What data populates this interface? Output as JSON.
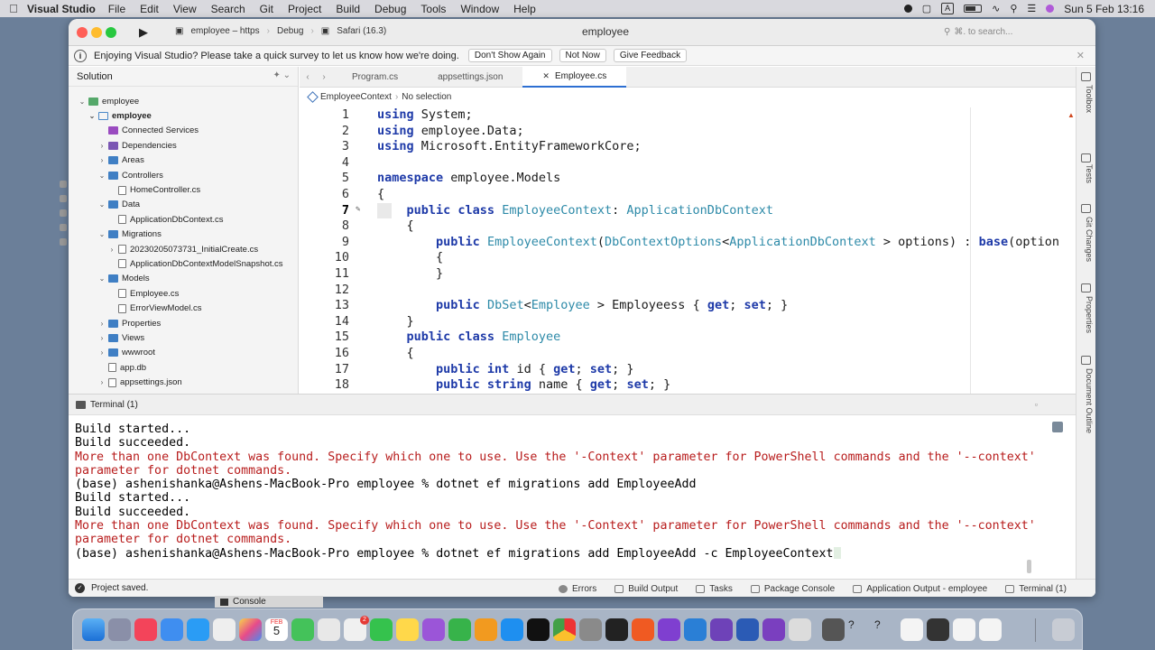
{
  "menubar": {
    "app_name": "Visual Studio",
    "items": [
      "File",
      "Edit",
      "View",
      "Search",
      "Git",
      "Project",
      "Build",
      "Debug",
      "Tools",
      "Window",
      "Help"
    ],
    "input_source": "A",
    "datetime": "Sun 5 Feb  13:16"
  },
  "titlebar": {
    "run_target": "employee – https",
    "configuration": "Debug",
    "device": "Safari (16.3)",
    "window_title": "employee",
    "search_placeholder": "⌘. to search..."
  },
  "infobar": {
    "message": "Enjoying Visual Studio? Please take a quick survey to let us know how we're doing.",
    "buttons": [
      "Don't Show Again",
      "Not Now",
      "Give Feedback"
    ]
  },
  "solution": {
    "title": "Solution",
    "tree": [
      {
        "label": "employee",
        "depth": 0,
        "icon": "sln",
        "chevron": "down",
        "bold": false
      },
      {
        "label": "employee",
        "depth": 1,
        "icon": "prj",
        "chevron": "down",
        "bold": true
      },
      {
        "label": "Connected Services",
        "depth": 2,
        "icon": "svc",
        "chevron": "",
        "bold": false
      },
      {
        "label": "Dependencies",
        "depth": 2,
        "icon": "proj",
        "chevron": "right",
        "bold": false
      },
      {
        "label": "Areas",
        "depth": 2,
        "icon": "folder",
        "chevron": "right",
        "bold": false
      },
      {
        "label": "Controllers",
        "depth": 2,
        "icon": "folder",
        "chevron": "down",
        "bold": false
      },
      {
        "label": "HomeController.cs",
        "depth": 3,
        "icon": "file",
        "chevron": "",
        "bold": false
      },
      {
        "label": "Data",
        "depth": 2,
        "icon": "folder",
        "chevron": "down",
        "bold": false
      },
      {
        "label": "ApplicationDbContext.cs",
        "depth": 3,
        "icon": "file",
        "chevron": "",
        "bold": false
      },
      {
        "label": "Migrations",
        "depth": 2,
        "icon": "folder",
        "chevron": "down",
        "bold": false
      },
      {
        "label": "20230205073731_InitialCreate.cs",
        "depth": 3,
        "icon": "file",
        "chevron": "right",
        "bold": false
      },
      {
        "label": "ApplicationDbContextModelSnapshot.cs",
        "depth": 3,
        "icon": "file",
        "chevron": "",
        "bold": false
      },
      {
        "label": "Models",
        "depth": 2,
        "icon": "folder",
        "chevron": "down",
        "bold": false
      },
      {
        "label": "Employee.cs",
        "depth": 3,
        "icon": "file",
        "chevron": "",
        "bold": false
      },
      {
        "label": "ErrorViewModel.cs",
        "depth": 3,
        "icon": "file",
        "chevron": "",
        "bold": false
      },
      {
        "label": "Properties",
        "depth": 2,
        "icon": "folder",
        "chevron": "right",
        "bold": false
      },
      {
        "label": "Views",
        "depth": 2,
        "icon": "folder",
        "chevron": "right",
        "bold": false
      },
      {
        "label": "wwwroot",
        "depth": 2,
        "icon": "folder",
        "chevron": "right",
        "bold": false
      },
      {
        "label": "app.db",
        "depth": 2,
        "icon": "file",
        "chevron": "",
        "bold": false
      },
      {
        "label": "appsettings.json",
        "depth": 2,
        "icon": "file",
        "chevron": "right",
        "bold": false
      }
    ]
  },
  "editor": {
    "tabs": [
      {
        "label": "Program.cs",
        "active": false
      },
      {
        "label": "appsettings.json",
        "active": false
      },
      {
        "label": "Employee.cs",
        "active": true
      }
    ],
    "breadcrumb": [
      "EmployeeContext",
      "No selection"
    ],
    "current_line": 7,
    "lines": [
      {
        "n": 1,
        "tokens": [
          [
            "kw",
            "using"
          ],
          [
            "",
            "System;"
          ]
        ]
      },
      {
        "n": 2,
        "tokens": [
          [
            "kw",
            "using"
          ],
          [
            "",
            "employee.Data;"
          ]
        ]
      },
      {
        "n": 3,
        "tokens": [
          [
            "kw",
            "using"
          ],
          [
            "",
            "Microsoft.EntityFrameworkCore;"
          ]
        ]
      },
      {
        "n": 4,
        "tokens": []
      },
      {
        "n": 5,
        "tokens": [
          [
            "kw",
            "namespace"
          ],
          [
            "",
            "employee.Models"
          ]
        ]
      },
      {
        "n": 6,
        "tokens": [
          [
            "",
            "{"
          ]
        ]
      },
      {
        "n": 7,
        "tokens": [
          [
            "",
            "    "
          ],
          [
            "kw",
            "public class"
          ],
          [
            "ty",
            "EmployeeContext"
          ],
          [
            "",
            ":"
          ],
          [
            "ty",
            "ApplicationDbContext"
          ]
        ]
      },
      {
        "n": 8,
        "tokens": [
          [
            "",
            "    {"
          ]
        ]
      },
      {
        "n": 9,
        "tokens": [
          [
            "",
            "        "
          ],
          [
            "kw",
            "public"
          ],
          [
            "ty",
            "EmployeeContext"
          ],
          [
            "",
            "("
          ],
          [
            "ty",
            "DbContextOptions"
          ],
          [
            "",
            "<"
          ],
          [
            "ty",
            "ApplicationDbContext"
          ],
          [
            "",
            "> options) :"
          ],
          [
            "kw",
            "base"
          ],
          [
            "",
            "(option"
          ]
        ]
      },
      {
        "n": 10,
        "tokens": [
          [
            "",
            "        {"
          ]
        ]
      },
      {
        "n": 11,
        "tokens": [
          [
            "",
            "        }"
          ]
        ]
      },
      {
        "n": 12,
        "tokens": []
      },
      {
        "n": 13,
        "tokens": [
          [
            "",
            "        "
          ],
          [
            "kw",
            "public"
          ],
          [
            "ty",
            "DbSet"
          ],
          [
            "",
            "<"
          ],
          [
            "ty",
            "Employee"
          ],
          [
            "",
            "> Employeess {"
          ],
          [
            "kw",
            "get"
          ],
          [
            "",
            ";"
          ],
          [
            "kw",
            "set"
          ],
          [
            "",
            "; }"
          ]
        ]
      },
      {
        "n": 14,
        "tokens": [
          [
            "",
            "    }"
          ]
        ]
      },
      {
        "n": 15,
        "tokens": [
          [
            "",
            "    "
          ],
          [
            "kw",
            "public class"
          ],
          [
            "ty",
            "Employee"
          ]
        ]
      },
      {
        "n": 16,
        "tokens": [
          [
            "",
            "    {"
          ]
        ]
      },
      {
        "n": 17,
        "tokens": [
          [
            "",
            "        "
          ],
          [
            "kw",
            "public int"
          ],
          [
            "",
            "id {"
          ],
          [
            "kw",
            "get"
          ],
          [
            "",
            ";"
          ],
          [
            "kw",
            "set"
          ],
          [
            "",
            "; }"
          ]
        ]
      },
      {
        "n": 18,
        "tokens": [
          [
            "",
            "        "
          ],
          [
            "kw",
            "public string"
          ],
          [
            "",
            "name {"
          ],
          [
            "kw",
            "get"
          ],
          [
            "",
            ";"
          ],
          [
            "kw",
            "set"
          ],
          [
            "",
            "; }"
          ]
        ]
      }
    ]
  },
  "right_toolbox": [
    "Toolbox",
    "Tests",
    "Git Changes",
    "Properties",
    "Document Outline"
  ],
  "terminal": {
    "title": "Terminal (1)",
    "lines": [
      {
        "text": "Build started...",
        "error": false
      },
      {
        "text": "Build succeeded.",
        "error": false
      },
      {
        "text": "More than one DbContext was found. Specify which one to use. Use the '-Context' parameter for PowerShell commands and the '--context'",
        "error": true
      },
      {
        "text": "parameter for dotnet commands.",
        "error": true
      },
      {
        "text": "(base) ashenishanka@Ashens-MacBook-Pro employee % dotnet ef migrations add EmployeeAdd",
        "error": false
      },
      {
        "text": "Build started...",
        "error": false
      },
      {
        "text": "Build succeeded.",
        "error": false
      },
      {
        "text": "More than one DbContext was found. Specify which one to use. Use the '-Context' parameter for PowerShell commands and the '--context'",
        "error": true
      },
      {
        "text": "parameter for dotnet commands.",
        "error": true
      },
      {
        "text": "(base) ashenishanka@Ashens-MacBook-Pro employee % dotnet ef migrations add EmployeeAdd -c EmployeeContext",
        "error": false,
        "cursor": true
      }
    ]
  },
  "statusbar": {
    "message": "Project saved.",
    "items": [
      "Errors",
      "Build Output",
      "Tasks",
      "Package Console",
      "Application Output - employee",
      "Terminal (1)"
    ]
  },
  "console_label": "Console",
  "dock": {
    "calendar_month": "FEB",
    "calendar_day": "5",
    "badge": "2"
  }
}
